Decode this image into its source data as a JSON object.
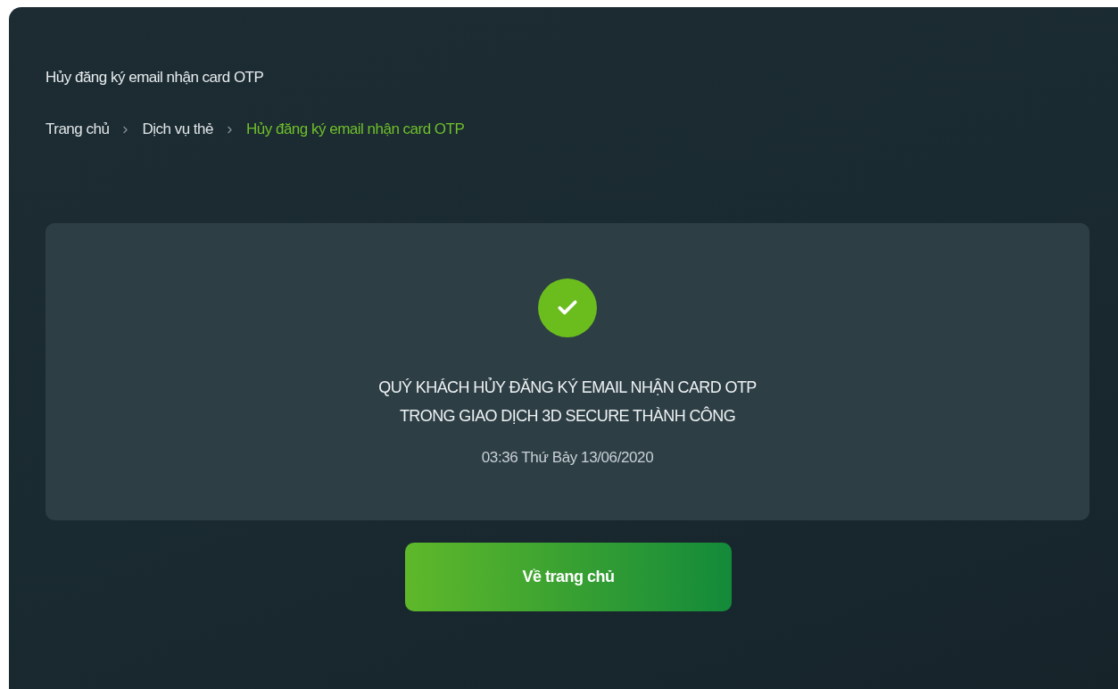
{
  "page_title": "Hủy đăng ký email nhận card OTP",
  "breadcrumb": [
    {
      "label": "Trang chủ",
      "selected": false
    },
    {
      "label": "Dịch vụ thẻ",
      "selected": false
    },
    {
      "label": "Hủy đăng ký email nhận card OTP",
      "selected": true
    }
  ],
  "result": {
    "success": true,
    "message_lines": [
      "QUÝ KHÁCH HỦY ĐĂNG KÝ EMAIL NHẬN CARD OTP",
      "TRONG GIAO DỊCH 3D SECURE THÀNH CÔNG"
    ],
    "datetime": "03:36 Thứ Bảy 13/06/2020"
  },
  "button": "Về trang chủ"
}
